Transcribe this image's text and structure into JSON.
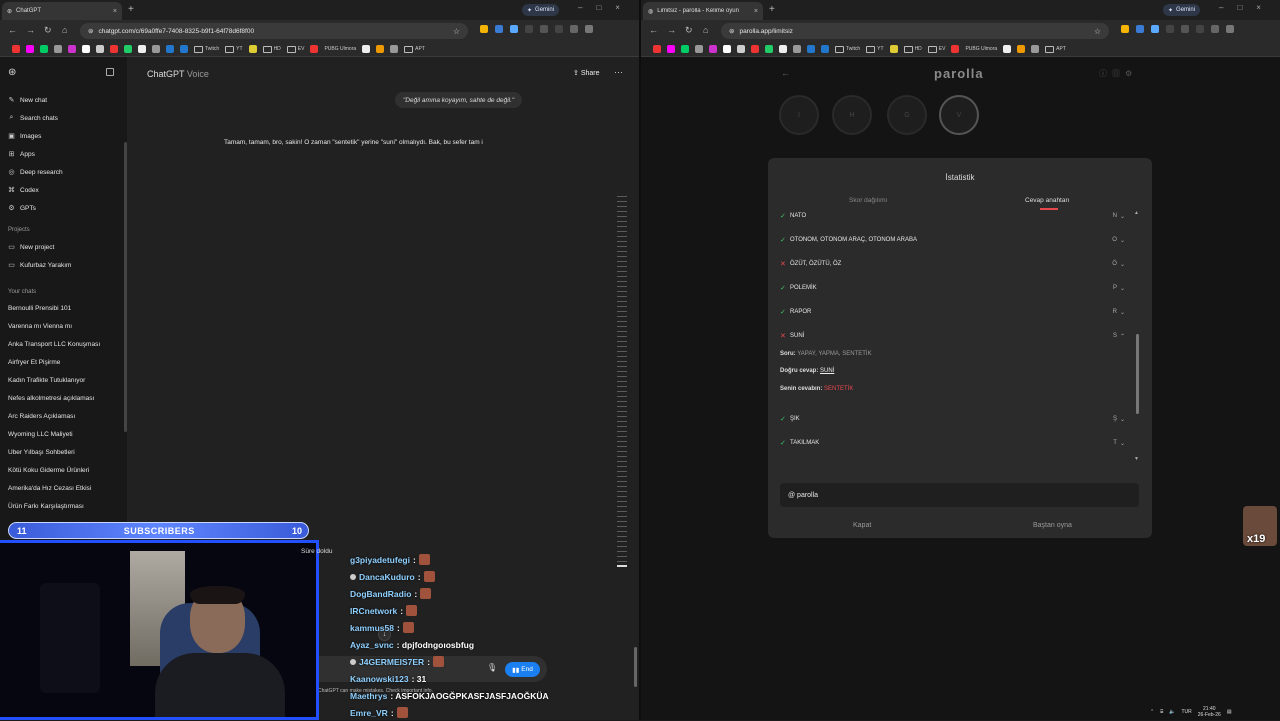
{
  "left_browser": {
    "tab_title": "ChatGPT",
    "gemini": "Gemini",
    "url": "chatgpt.com/c/69a0ffe7-7408-8325-b9f1-64f78d6f8f00",
    "bookmarks": [
      "Twitch",
      "YT",
      "HD",
      "EV",
      "PUBG Ulmora",
      "APT"
    ]
  },
  "chatgpt": {
    "title": "ChatGPT",
    "title_suffix": "Voice",
    "share": "Share",
    "sidebar_nav": [
      {
        "icon": "✎",
        "label": "New chat"
      },
      {
        "icon": "⌕",
        "label": "Search chats"
      },
      {
        "icon": "▣",
        "label": "Images"
      },
      {
        "icon": "⊞",
        "label": "Apps"
      },
      {
        "icon": "◎",
        "label": "Deep research"
      },
      {
        "icon": "⌘",
        "label": "Codex"
      },
      {
        "icon": "⚙",
        "label": "GPTs"
      }
    ],
    "projects_heading": "Projects",
    "projects": [
      {
        "icon": "▭",
        "label": "New project"
      },
      {
        "icon": "▭",
        "label": "Kufurbaz Yarakım"
      }
    ],
    "chats_heading": "Your chats",
    "chats": [
      "Bernoulli Prensibi 101",
      "Varenna mı Vienna mı",
      "Anka Transport LLC Konuşması",
      "Airfryer Et Pişirme",
      "Kadın Trafikte Tutuklanıyor",
      "Nefes alkolmetresi açıklaması",
      "Arc Raiders Açıklaması",
      "Wyoming LLC Maliyeti",
      "Uber Yılbaşı Sohbetleri",
      "Kötü Koku Giderme Ürünleri",
      "Amerika'da Hız Cezası Etkisi",
      "Ürün Farkı Karşılaştırması"
    ],
    "user_message": "\"Değil amına koyayım, sahte de değil.\"",
    "assistant_message": "Tamam, tamam, bro, sakin! O zaman \"sentetik\" yerine \"suni\" olmalıydı. Bak, bu sefer tam i",
    "end_button": "End",
    "disclaimer": "ChatGPT can make mistakes. Check important info."
  },
  "overlay": {
    "subs_left": "11",
    "subs_label": "SUBSCRIBERS",
    "subs_right": "10",
    "emote_count": "x19"
  },
  "right_browser": {
    "tab_title": "Limitsiz - parolla - Kelime oyunu",
    "gemini": "Gemini",
    "url": "parolla.app/limitsiz",
    "bookmarks": [
      "Twitch",
      "YT",
      "HD",
      "EV",
      "PUBG Ulmora",
      "APT"
    ]
  },
  "parolla": {
    "logo": "parolla",
    "circles": [
      "I",
      "H",
      "G",
      "V"
    ],
    "modal_title": "İstatistik",
    "tab_scores": "Skor dağılımı",
    "tab_answers": "Cevap anahtarı",
    "rows": [
      {
        "status": "ok",
        "word": "NATO",
        "letter": "N",
        "chev": "⌄"
      },
      {
        "status": "ok",
        "word": "OTONOM, OTONOM ARAÇ, OTONOM ARABA",
        "letter": "O",
        "chev": "⌄"
      },
      {
        "status": "no",
        "word": "ÖZÜT, ÖZÜTÜ, ÖZ",
        "letter": "Ö",
        "chev": "⌄"
      },
      {
        "status": "ok",
        "word": "POLEMİK",
        "letter": "P",
        "chev": "⌄"
      },
      {
        "status": "ok",
        "word": "RAPOR",
        "letter": "R",
        "chev": "⌄"
      },
      {
        "status": "no",
        "word": "SUNİ",
        "letter": "S",
        "chev": "⌃"
      },
      {
        "status": "ok",
        "word": "ŞIK",
        "letter": "Ş",
        "chev": "⌄"
      },
      {
        "status": "ok",
        "word": "TAKILMAK",
        "letter": "T",
        "chev": "⌄"
      }
    ],
    "question_label": "Soru:",
    "question_text": "YAPAY, YAPMA, SENTETİK",
    "correct_label": "Doğru cevap:",
    "correct_answer": "SUNİ",
    "your_label": "Senin cevabın:",
    "your_answer": "SENTETİK",
    "search_value": "@ parolla",
    "close_button": "Kapat",
    "replay_button": "Baştan oyna",
    "time_up": "Süre doldu"
  },
  "chat_messages": [
    {
      "user": "g3piyadetufegi",
      "text": ":"
    },
    {
      "user": "DancaKuduro",
      "text": ":"
    },
    {
      "user": "DogBandRadio",
      "text": ":"
    },
    {
      "user": "IRCnetwork",
      "text": ":"
    },
    {
      "user": "kammus58",
      "text": ":"
    },
    {
      "user": "Ayaz_svnc",
      "text": ": dpjfodngoıosbfug"
    },
    {
      "user": "J4GERMEIS7ER",
      "text": ":"
    },
    {
      "user": "Kaanowski123",
      "text": ": 31"
    },
    {
      "user": "Maethrys",
      "text": ": ASFOKJAOGĞPKASFJASFJAOĞKÜA"
    },
    {
      "user": "Emre_VR",
      "text": ":"
    }
  ],
  "taskbar": {
    "lang": "TUR",
    "time": "21:40",
    "date": "26-Feb-26"
  }
}
